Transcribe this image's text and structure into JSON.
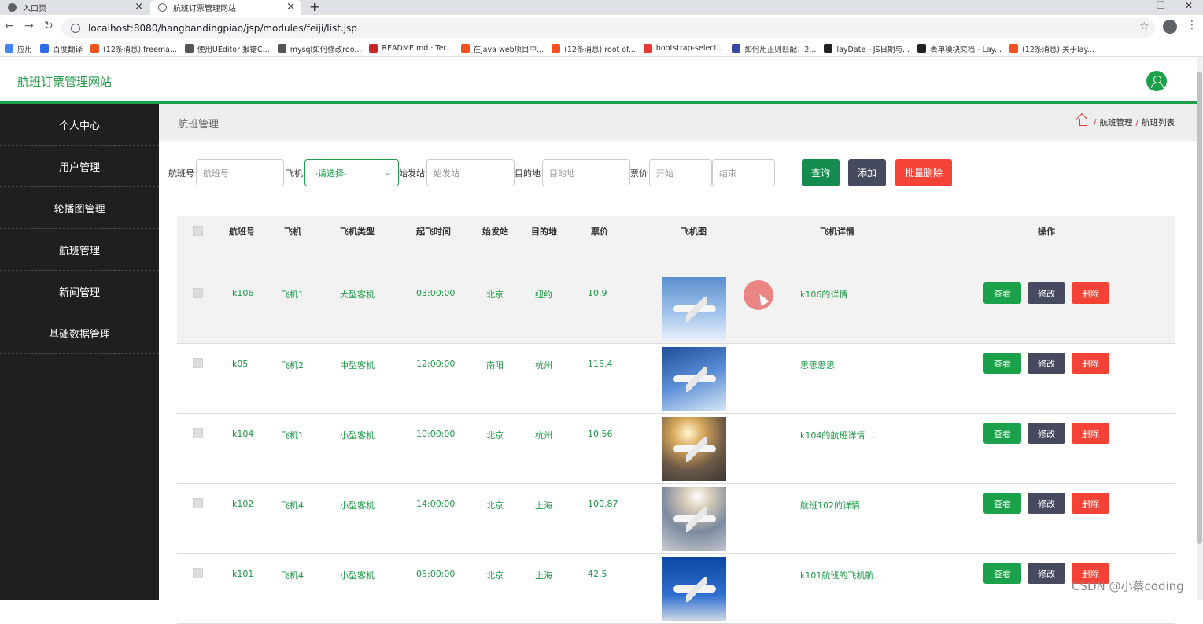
{
  "browser": {
    "tabs": [
      {
        "title": "入口页",
        "active": false
      },
      {
        "title": "航班订票管理网站",
        "active": true
      }
    ],
    "url": "localhost:8080/hangbandingpiao/jsp/modules/feiji/list.jsp",
    "bookmarks": [
      {
        "label": "应用",
        "color": "#4285f4"
      },
      {
        "label": "百度翻译",
        "color": "#2b6de5"
      },
      {
        "label": "(12条消息) freema...",
        "color": "#f4511e"
      },
      {
        "label": "使用UEditor 报错C...",
        "color": "#555555"
      },
      {
        "label": "mysql如何修改roo...",
        "color": "#555555"
      },
      {
        "label": "README.md · Ter...",
        "color": "#c62828"
      },
      {
        "label": "在java web项目中...",
        "color": "#f4511e"
      },
      {
        "label": "(12条消息) root of...",
        "color": "#f4511e"
      },
      {
        "label": "bootstrap-select...",
        "color": "#e53935"
      },
      {
        "label": "如何用正则匹配：2...",
        "color": "#3949ab"
      },
      {
        "label": "layDate - JS日期与...",
        "color": "#222222"
      },
      {
        "label": "表单模块文档 - Lay...",
        "color": "#222222"
      },
      {
        "label": "(12条消息) 关于lay...",
        "color": "#f4511e"
      }
    ]
  },
  "header": {
    "site_title": "航班订票管理网站"
  },
  "sidebar": {
    "items": [
      {
        "label": "个人中心"
      },
      {
        "label": "用户管理"
      },
      {
        "label": "轮播图管理"
      },
      {
        "label": "航班管理"
      },
      {
        "label": "新闻管理"
      },
      {
        "label": "基础数据管理"
      }
    ]
  },
  "breadcrumb": {
    "title": "航班管理",
    "path": [
      "航班管理",
      "航班列表"
    ]
  },
  "filters": {
    "flight_no": {
      "label": "航班号",
      "placeholder": "航班号"
    },
    "plane": {
      "label": "飞机",
      "value": "-请选择-"
    },
    "origin": {
      "label": "始发站",
      "placeholder": "始发站"
    },
    "destination": {
      "label": "目的地",
      "placeholder": "目的地"
    },
    "price": {
      "label": "票价",
      "start_placeholder": "开始",
      "end_placeholder": "结束"
    },
    "search_label": "查询",
    "add_label": "添加",
    "batch_delete_label": "批量删除"
  },
  "table": {
    "headers": [
      "航班号",
      "飞机",
      "飞机类型",
      "起飞时间",
      "始发站",
      "目的地",
      "票价",
      "飞机图",
      "飞机详情",
      "操作"
    ],
    "rows": [
      {
        "flight_no": "k106",
        "plane": "飞机1",
        "type": "大型客机",
        "time": "03:00:00",
        "origin": "北京",
        "dest": "纽约",
        "price": "10.9",
        "detail": "k106的详情",
        "sky": "linear-gradient(180deg,#5a8fcf 0%,#9fc2ea 55%,#e8f0fa 100%)"
      },
      {
        "flight_no": "k05",
        "plane": "飞机2",
        "type": "中型客机",
        "time": "12:00:00",
        "origin": "南阳",
        "dest": "杭州",
        "price": "115.4",
        "detail": "思思思思",
        "sky": "linear-gradient(160deg,#1f4e9a 0%,#5a8ed6 50%,#d8e6f5 100%)"
      },
      {
        "flight_no": "k104",
        "plane": "飞机1",
        "type": "小型客机",
        "time": "10:00:00",
        "origin": "北京",
        "dest": "杭州",
        "price": "10.56",
        "detail": "k104的航班详情 ...",
        "sky": "radial-gradient(circle at 40% 25%,#fff6d0 0%,#d8a85a 25%,#6d5a48 60%,#3a3634 100%)"
      },
      {
        "flight_no": "k102",
        "plane": "飞机4",
        "type": "小型客机",
        "time": "14:00:00",
        "origin": "北京",
        "dest": "上海",
        "price": "100.87",
        "detail": "航班102的详情",
        "sky": "radial-gradient(circle at 55% 15%,#ffffff 0%,#d9cdb8 20%,#7d8aa0 55%,#c9ccd2 100%)"
      },
      {
        "flight_no": "k101",
        "plane": "飞机4",
        "type": "小型客机",
        "time": "05:00:00",
        "origin": "北京",
        "dest": "上海",
        "price": "42.5",
        "detail": "k101航班的飞机航...",
        "sky": "linear-gradient(180deg,#0d47a1 0%,#2f6fd0 60%,#cfd8e6 100%)"
      }
    ],
    "actions": {
      "view": "查看",
      "edit": "修改",
      "delete": "删除"
    }
  },
  "colors": {
    "brand": "#1aa14a",
    "danger": "#f44336",
    "dark": "#464a5e",
    "sidebar": "#1f1f1f"
  },
  "watermark": "CSDN @小蔡coding"
}
